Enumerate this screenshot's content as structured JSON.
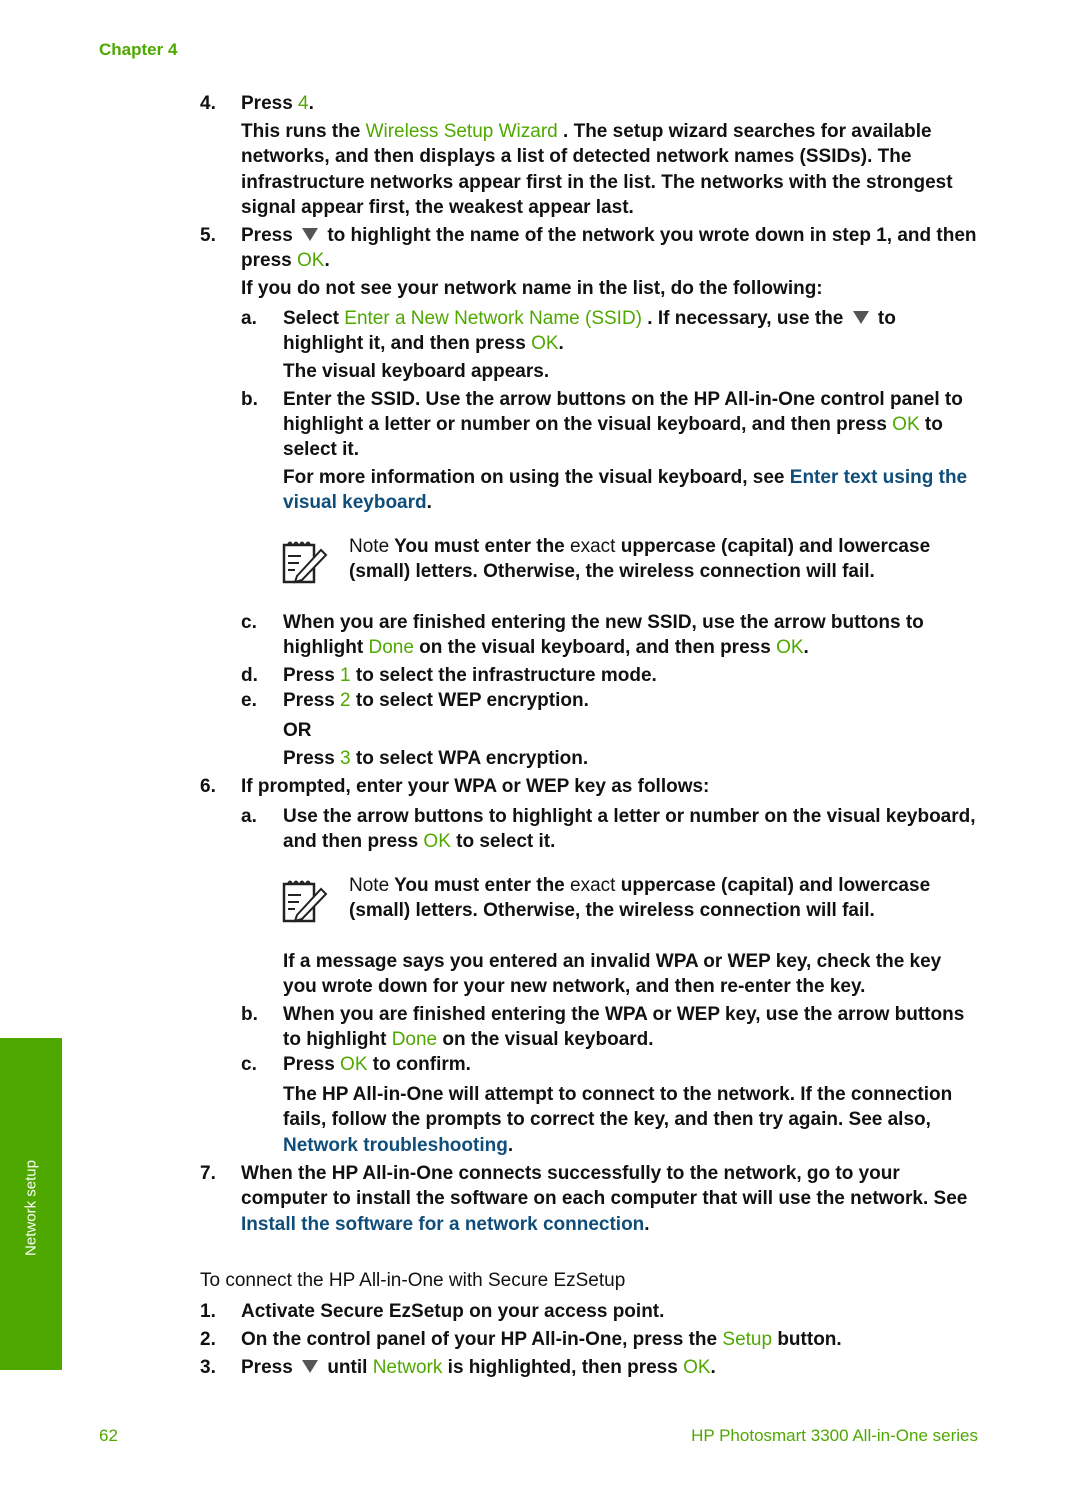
{
  "header": {
    "chapter": "Chapter 4"
  },
  "side_tab": {
    "label": "Network setup"
  },
  "steps": {
    "s4": {
      "num": "4.",
      "press": "Press ",
      "key": "4",
      "period": ".",
      "p1_a": "This runs the ",
      "p1_wizard": "Wireless Setup Wizard",
      "p1_b": " . The setup wizard searches for available",
      "p2": "networks, and then displays a list of detected network names (SSIDs). The",
      "p3": "infrastructure networks appear first in the list. The networks with the strongest",
      "p4": "signal appear first, the weakest appear last."
    },
    "s5": {
      "num": "5.",
      "l1_a": "Press ",
      "l1_b": " to highlight the name of the network you wrote down in step 1, and then",
      "l2_a": "press ",
      "l2_ok": "OK",
      "l2_b": ".",
      "l3": "If you do not see your network name in the list, do the following:",
      "a": {
        "letter": "a.",
        "l1_a": "Select ",
        "l1_opt": "Enter a New Network Name (SSID)",
        "l1_b": " . If necessary, use the ",
        "l1_c": " to",
        "l2_a": "highlight it, and then press ",
        "l2_ok": "OK",
        "l2_b": ".",
        "l3": "The visual keyboard appears."
      },
      "b": {
        "letter": "b.",
        "l1": "Enter the SSID. Use the arrow buttons on the HP All-in-One control panel to",
        "l2_a": "highlight a letter or number on the visual keyboard, and then press ",
        "l2_ok": "OK",
        "l2_b": " to",
        "l3": "select it.",
        "l4": "For more information on using the visual keyboard, see ",
        "l4_link": "Enter text using the",
        "l5_link": "visual keyboard",
        "l5_b": "."
      },
      "note1": {
        "label": "Note",
        "l1_a": "  You must enter the ",
        "l1_exact": "exact",
        "l1_b": "  uppercase (capital) and lowercase",
        "l2": "(small) letters. Otherwise, the wireless connection will fail."
      },
      "c": {
        "letter": "c.",
        "l1": "When you are finished entering the new SSID, use the arrow buttons to",
        "l2_a": "highlight ",
        "l2_done": "Done",
        "l2_b": "  on the visual keyboard, and then press ",
        "l2_ok": "OK",
        "l2_c": "."
      },
      "d": {
        "letter": "d.",
        "a": "Press ",
        "key": "1",
        "b": " to select the infrastructure mode."
      },
      "e": {
        "letter": "e.",
        "a": "Press ",
        "key": "2",
        "b": " to select WEP encryption.",
        "or": "OR",
        "c": "Press ",
        "key2": "3",
        "d": " to select WPA encryption."
      }
    },
    "s6": {
      "num": "6.",
      "l1": "If prompted, enter your WPA or WEP key as follows:",
      "a": {
        "letter": "a.",
        "l1": "Use the arrow buttons to highlight a letter or number on the visual keyboard,",
        "l2_a": "and then press ",
        "l2_ok": "OK",
        "l2_b": " to select it."
      },
      "note2": {
        "label": "Note",
        "l1_a": "  You must enter the ",
        "l1_exact": "exact",
        "l1_b": "  uppercase (capital) and lowercase",
        "l2": "(small) letters. Otherwise, the wireless connection will fail."
      },
      "msg1": "If a message says you entered an invalid WPA or WEP key, check the key",
      "msg2": "you wrote down for your new network, and then re-enter the key.",
      "b": {
        "letter": "b.",
        "l1": "When you are finished entering the WPA or WEP key, use the arrow buttons",
        "l2_a": "to highlight ",
        "l2_done": "Done",
        "l2_b": "  on the visual keyboard."
      },
      "c": {
        "letter": "c.",
        "a": "Press ",
        "ok": "OK",
        "b": " to confirm.",
        "p1": "The HP All-in-One will attempt to connect to the network. If the connection",
        "p2": "fails, follow the prompts to correct the key, and then try again. See also,",
        "p3_link": "Network troubleshooting",
        "p3_b": "."
      }
    },
    "s7": {
      "num": "7.",
      "l1": "When the HP All-in-One connects successfully to the network, go to your",
      "l2": "computer to install the software on each computer that will use the network. See",
      "l3_link": "Install the software for a network connection",
      "l3_b": "."
    }
  },
  "ezsetup": {
    "heading": "To connect the HP All-in-One with Secure EzSetup",
    "s1": {
      "num": "1.",
      "text": "Activate Secure EzSetup on your access point."
    },
    "s2": {
      "num": "2.",
      "a": "On the control panel of your HP All-in-One, press the ",
      "btn": "Setup",
      "b": "  button."
    },
    "s3": {
      "num": "3.",
      "a": "Press ",
      "b": " until ",
      "menu": "Network",
      "c": "  is highlighted, then press ",
      "ok": "OK",
      "d": "."
    }
  },
  "footer": {
    "page": "62",
    "product": "HP Photosmart 3300 All-in-One series"
  }
}
